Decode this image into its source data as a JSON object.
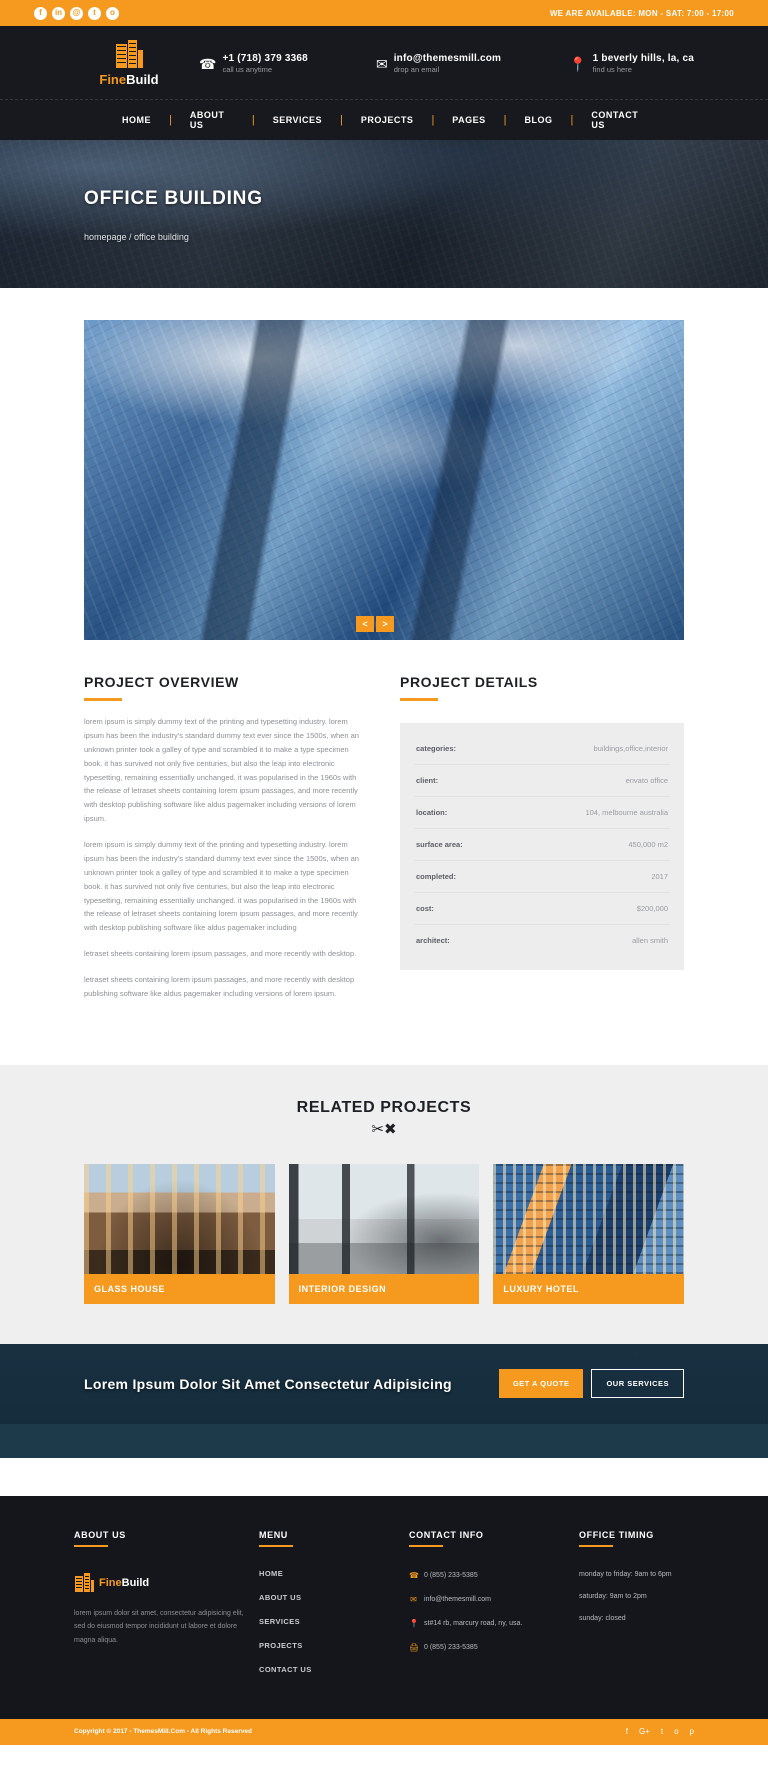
{
  "topbar": {
    "social": [
      "f",
      "in",
      "@",
      "t",
      "o"
    ],
    "availability": "WE ARE AVAILABLE: MON - SAT: 7:00 - 17:00"
  },
  "header": {
    "logo_a": "Fine",
    "logo_b": "Build",
    "contacts": [
      {
        "icon": "phone-icon",
        "title": "+1 (718) 379 3368",
        "sub": "call us anytime"
      },
      {
        "icon": "envelope-icon",
        "title": "info@themesmill.com",
        "sub": "drop an email"
      },
      {
        "icon": "map-pin-icon",
        "title": "1 beverly hills, la, ca",
        "sub": "find us here"
      }
    ]
  },
  "nav": {
    "items": [
      "HOME",
      "ABOUT US",
      "SERVICES",
      "PROJECTS",
      "PAGES",
      "BLOG",
      "CONTACT US"
    ],
    "separator": "|"
  },
  "banner": {
    "title": "OFFICE BUILDING",
    "breadcrumb": "homepage / office building"
  },
  "slider": {
    "prev": "<",
    "next": ">"
  },
  "overview": {
    "title": "PROJECT OVERVIEW",
    "paragraphs": [
      "lorem ipsum is simply dummy text of the printing and typesetting industry. lorem ipsum has been the industry's standard dummy text ever since the 1500s, when an unknown printer took a galley of type and scrambled it to make a type specimen book. it has survived not only five centuries, but also the leap into electronic typesetting, remaining essentially unchanged. it was popularised in the 1960s with the release of letraset sheets containing lorem ipsum passages, and more recently with desktop publishing software like aldus pagemaker including versions of lorem ipsum.",
      "lorem ipsum is simply dummy text of the printing and typesetting industry. lorem ipsum has been the industry's standard dummy text ever since the 1500s, when an unknown printer took a galley of type and scrambled it to make a type specimen book. it has survived not only five centuries, but also the leap into electronic typesetting, remaining essentially unchanged. it was popularised in the 1960s with the release of letraset sheets containing lorem ipsum passages, and more recently with desktop publishing software like aldus pagemaker including",
      "letraset sheets containing lorem ipsum passages, and more recently with desktop.",
      "letraset sheets containing lorem ipsum passages, and more recently with desktop publishing software like aldus pagemaker including versions of lorem ipsum."
    ]
  },
  "details": {
    "title": "PROJECT DETAILS",
    "rows": [
      {
        "key": "categories:",
        "value": "buildings,office,interior"
      },
      {
        "key": "client:",
        "value": "envato office"
      },
      {
        "key": "location:",
        "value": "104, melbourne australia"
      },
      {
        "key": "surface area:",
        "value": "450,000 m2"
      },
      {
        "key": "completed:",
        "value": "2017"
      },
      {
        "key": "cost:",
        "value": "$200,000"
      },
      {
        "key": "architect:",
        "value": "allen smith"
      }
    ]
  },
  "related": {
    "title": "RELATED PROJECTS",
    "icon": "crossed-tools-icon",
    "cards": [
      {
        "label": "GLASS HOUSE"
      },
      {
        "label": "INTERIOR DESIGN"
      },
      {
        "label": "LUXURY HOTEL"
      }
    ]
  },
  "cta": {
    "heading": "Lorem Ipsum Dolor Sit Amet Consectetur Adipisicing",
    "primary": "GET A QUOTE",
    "secondary": "OUR SERVICES"
  },
  "footer": {
    "about": {
      "heading": "ABOUT US",
      "logo_a": "Fine",
      "logo_b": "Build",
      "text": "lorem ipsum dolor sit amet, consectetur adipisicing elit, sed do eiusmod tempor incididunt ut labore et dolore magna aliqua."
    },
    "menu": {
      "heading": "MENU",
      "items": [
        "HOME",
        "ABOUT US",
        "SERVICES",
        "PROJECTS",
        "CONTACT US"
      ]
    },
    "contact": {
      "heading": "CONTACT INFO",
      "items": [
        {
          "icon": "phone-icon",
          "text": "0 (855) 233-5385"
        },
        {
          "icon": "envelope-icon",
          "text": "info@themesmill.com"
        },
        {
          "icon": "map-pin-icon",
          "text": "st#14 rb, marcury road, ny, usa."
        },
        {
          "icon": "fax-icon",
          "text": "0 (855) 233-5385"
        }
      ]
    },
    "timing": {
      "heading": "OFFICE TIMING",
      "items": [
        "monday to friday: 9am to 6pm",
        "saturday: 9am to 2pm",
        "sunday: closed"
      ]
    }
  },
  "copyright": {
    "text": "Copyright © 2017 - ThemesMill.Com - All Rights Reserved",
    "social": [
      "f",
      "G+",
      "t",
      "o",
      "p"
    ]
  },
  "colors": {
    "accent": "#f59a1e",
    "dark": "#18191e",
    "footer": "#15161b",
    "panel": "#ededed"
  }
}
